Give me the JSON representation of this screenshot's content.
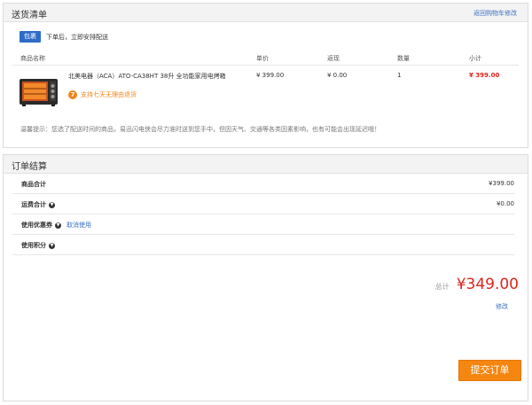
{
  "shipping": {
    "title": "送货清单",
    "back_link": "返回购物车修改",
    "badge": "包裹",
    "notice": "下单后，立即安排配送",
    "columns": {
      "name": "商品名称",
      "price": "单价",
      "cashback": "返现",
      "qty": "数量",
      "subtotal": "小计"
    },
    "item": {
      "name": "北美电器（ACA）ATO-CA38HT 38升 全功能家用电烤箱",
      "return_icon": "7",
      "return_text": "支持七天无理由退货",
      "price": "¥ 399.00",
      "cashback": "¥ 0.00",
      "qty": "1",
      "subtotal": "¥ 399.00",
      "image_icon": "oven-image"
    },
    "tip": "温馨提示：您选了配送时间的商品，易迅闪电侠会尽力准时送到您手中，但因天气、交通等各类因素影响，也有可能会出现延迟哦！"
  },
  "settlement": {
    "title": "订单结算",
    "rows": [
      {
        "label": "商品合计",
        "value": "¥399.00",
        "chevron": false,
        "link": ""
      },
      {
        "label": "运费合计",
        "value": "¥0.00",
        "chevron": true,
        "link": ""
      },
      {
        "label": "使用优惠券",
        "value": "",
        "chevron": true,
        "link": "取消使用"
      },
      {
        "label": "使用积分",
        "value": "",
        "chevron": true,
        "link": ""
      }
    ],
    "total_label": "总计",
    "total_amount": "¥349.00",
    "modify": "修改",
    "submit": "提交订单"
  },
  "colors": {
    "accent_blue": "#2e6bc9",
    "price_red": "#e2231a",
    "orange": "#f5860f"
  }
}
